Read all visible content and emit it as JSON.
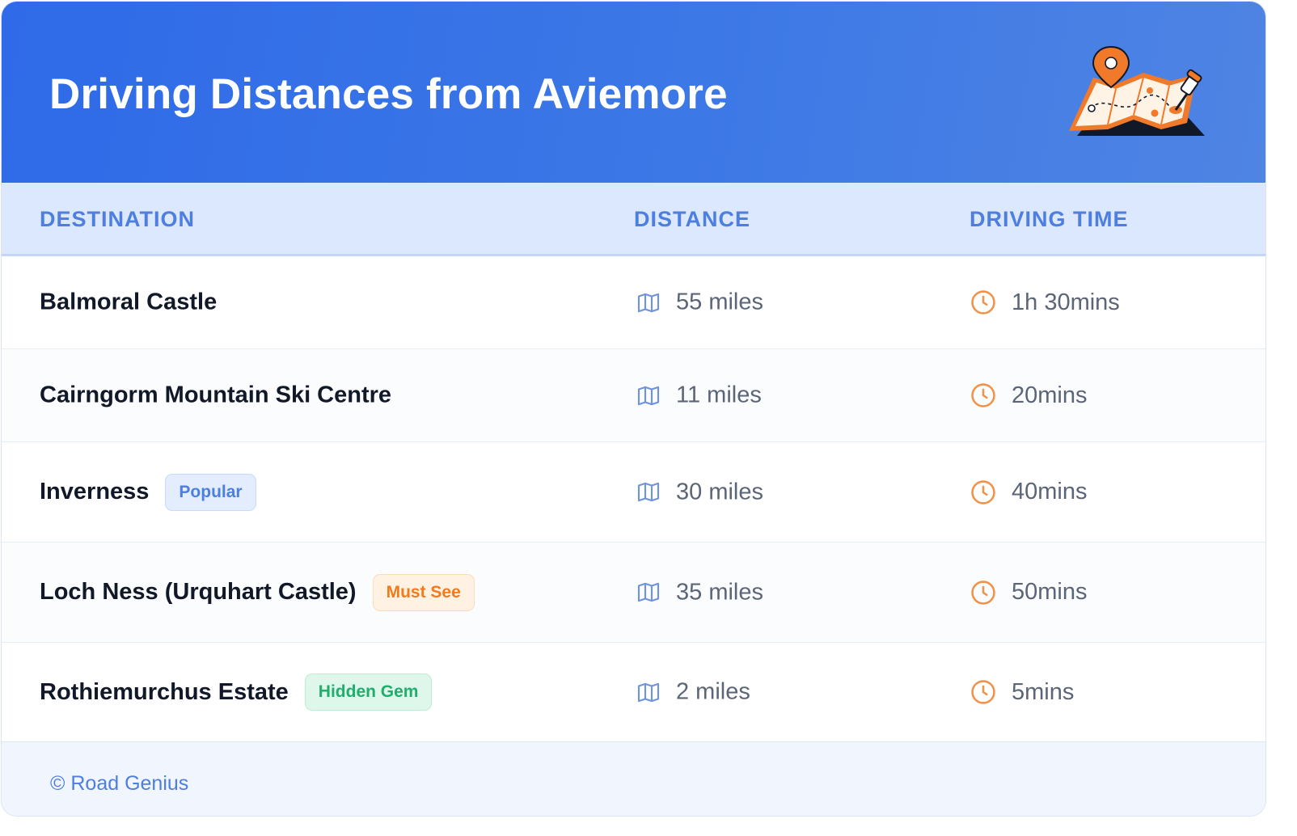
{
  "header": {
    "title": "Driving Distances from Aviemore",
    "icon": "map-with-pins-icon"
  },
  "table": {
    "columns": [
      "DESTINATION",
      "DISTANCE",
      "DRIVING TIME"
    ],
    "rows": [
      {
        "destination": "Balmoral Castle",
        "badge": "",
        "distance": "55 miles",
        "time": "1h 30mins"
      },
      {
        "destination": "Cairngorm Mountain Ski Centre",
        "badge": "",
        "distance": "11 miles",
        "time": "20mins"
      },
      {
        "destination": "Inverness",
        "badge": "Popular",
        "distance": "30 miles",
        "time": "40mins"
      },
      {
        "destination": "Loch Ness (Urquhart Castle)",
        "badge": "Must See",
        "distance": "35 miles",
        "time": "50mins"
      },
      {
        "destination": "Rothiemurchus Estate",
        "badge": "Hidden Gem",
        "distance": "2 miles",
        "time": "5mins"
      }
    ]
  },
  "footer": {
    "text": "© Road Genius"
  },
  "colors": {
    "header": "#3570e7",
    "accent_blue": "#4d7ee0",
    "badge_orange": "#f27a1a",
    "badge_green": "#1fae6b",
    "clock_orange": "#f0924a"
  }
}
